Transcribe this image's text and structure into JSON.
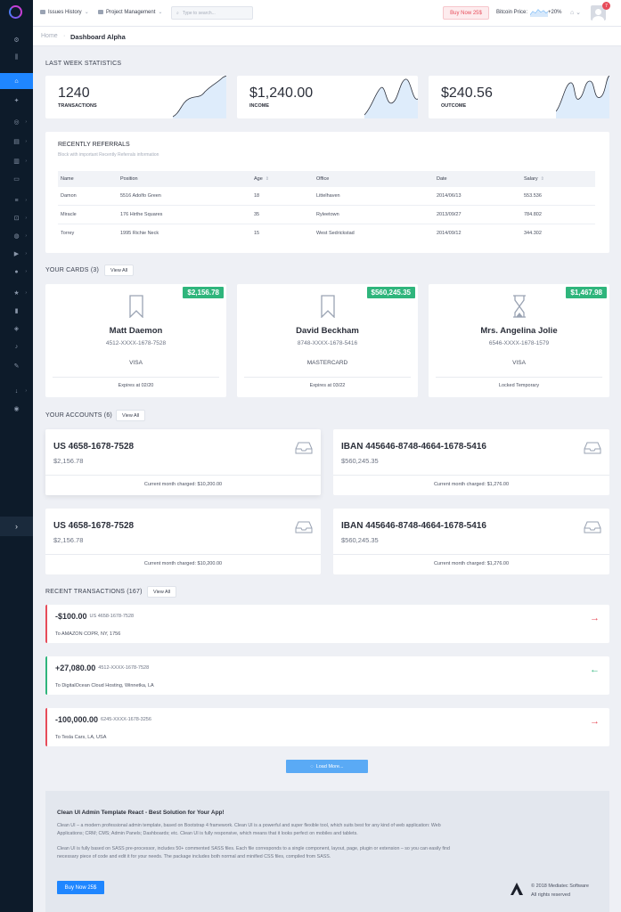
{
  "topbar": {
    "issues_label": "Issues History",
    "project_label": "Project Management",
    "search_placeholder": "Type to search...",
    "buy_label": "Buy Now 25$",
    "bitcoin_label": "Bitcoin Price:",
    "bitcoin_change": "+20%",
    "notification_count": "7"
  },
  "breadcrumb": {
    "home": "Home",
    "separator": "·",
    "current": "Dashboard Alpha"
  },
  "stats": {
    "title": "Last Week Statistics",
    "items": [
      {
        "value": "1240",
        "label": "Transactions"
      },
      {
        "value": "$1,240.00",
        "label": "Income"
      },
      {
        "value": "$240.56",
        "label": "Outcome"
      }
    ]
  },
  "referrals": {
    "title": "Recently Referrals",
    "subtitle": "Block with important Recently Referrals information",
    "columns": [
      "Name",
      "Position",
      "Age",
      "Office",
      "Date",
      "Salary"
    ],
    "sort_icon": "⇕",
    "rows": [
      [
        "Damon",
        "5516 Adolfo Green",
        "18",
        "Littelhaven",
        "2014/06/13",
        "553.536"
      ],
      [
        "Miracle",
        "176 Hirthe Squares",
        "35",
        "Ryleetown",
        "2013/09/27",
        "784.802"
      ],
      [
        "Torrey",
        "1995 Richie Neck",
        "15",
        "West Sedrickstad",
        "2014/09/12",
        "344.302"
      ]
    ]
  },
  "cards": {
    "title": "Your Cards (3)",
    "view_all": "View All",
    "items": [
      {
        "badge": "$2,156.78",
        "name": "Matt Daemon",
        "number": "4512-XXXX-1678-7528",
        "type": "VISA",
        "footer": "Expires at 02/20",
        "icon": "bookmark-icon"
      },
      {
        "badge": "$560,245.35",
        "name": "David Beckham",
        "number": "8748-XXXX-1678-5416",
        "type": "MASTERCARD",
        "footer": "Expires at 03/22",
        "icon": "bookmark-icon"
      },
      {
        "badge": "$1,467.98",
        "name": "Mrs. Angelina Jolie",
        "number": "6546-XXXX-1678-1579",
        "type": "VISA",
        "footer": "Locked Temporary",
        "icon": "hourglass-icon"
      }
    ]
  },
  "accounts": {
    "title": "Your Accounts (6)",
    "view_all": "View All",
    "items": [
      {
        "number": "US 4658-1678-7528",
        "balance": "$2,156.78",
        "footer": "Current month charged: $10,200.00"
      },
      {
        "number": "IBAN 445646-8748-4664-1678-5416",
        "balance": "$560,245.35",
        "footer": "Current month charged: $1,276.00"
      },
      {
        "number": "US 4658-1678-7528",
        "balance": "$2,156.78",
        "footer": "Current month charged: $10,200.00"
      },
      {
        "number": "IBAN 445646-8748-4664-1678-5416",
        "balance": "$560,245.35",
        "footer": "Current month charged: $1,276.00"
      }
    ]
  },
  "transactions": {
    "title": "Recent Transactions (167)",
    "view_all": "View All",
    "items": [
      {
        "amount": "-$100.00",
        "account": "US 4658-1678-7528",
        "to": "To AMAZON COPR, NY, 1756",
        "arrow": "→",
        "color": "#e74c5a"
      },
      {
        "amount": "+27,080.00",
        "account": "4512-XXXX-1678-7528",
        "to": "To DigitalOcean Cloud Hosting, Winnetka, LA",
        "arrow": "←",
        "color": "#2fb57c"
      },
      {
        "amount": "-100,000.00",
        "account": "6245-XXXX-1678-3256",
        "to": "To Tesla Cars, LA, USA",
        "arrow": "→",
        "color": "#e74c5a"
      }
    ],
    "load_more": "Load More..."
  },
  "footer": {
    "title": "Clean UI Admin Template React - Best Solution for Your App!",
    "p1": "Clean UI – a modern professional admin template, based on Bootstrap 4 framework. Clean UI is a powerful and super flexible tool, which suits best for any kind of web application: Web Applications; CRM; CMS; Admin Panels; Dashboards; etc. Clean UI is fully responsive, which means that it looks perfect on mobiles and tablets.",
    "p2": "Clean UI is fully based on SASS pre-processor, includes 50+ commented SASS files. Each file corresponds to a single component, layout, page, plugin or extension – so you can easily find necessary piece of code and edit it for your needs. The package includes both normal and minified CSS files, compiled from SASS.",
    "buy_label": "Buy Now 25$",
    "copyright": "© 2018 Mediatec Software",
    "rights": "All rights reserved"
  },
  "colors": {
    "accent": "#1f86ff",
    "positive": "#2fb57c",
    "negative": "#e74c5a",
    "sidebar": "#0d1b2a"
  }
}
